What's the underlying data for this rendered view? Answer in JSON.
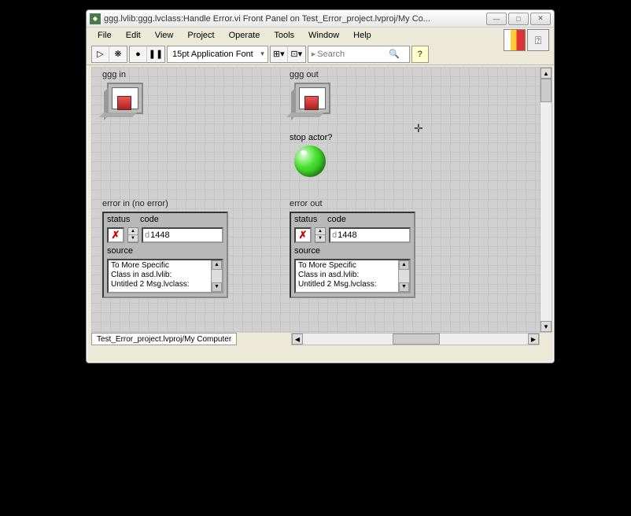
{
  "window": {
    "title": "ggg.lvlib:ggg.lvclass:Handle Error.vi Front Panel on Test_Error_project.lvproj/My Co..."
  },
  "menu": {
    "file": "File",
    "edit": "Edit",
    "view": "View",
    "project": "Project",
    "operate": "Operate",
    "tools": "Tools",
    "window": "Window",
    "help": "Help"
  },
  "toolbar": {
    "font": "15pt Application Font",
    "search_placeholder": "Search"
  },
  "controls": {
    "ggg_in_label": "ggg in",
    "ggg_out_label": "ggg out",
    "stop_actor_label": "stop actor?",
    "error_in_label": "error in (no error)",
    "error_out_label": "error out",
    "status_label": "status",
    "code_label": "code",
    "source_label": "source"
  },
  "error_in": {
    "status_symbol": "✗",
    "code": "1448",
    "source_lines": [
      "To More Specific",
      "Class in asd.lvlib:",
      "Untitled 2 Msg.lvclass:"
    ]
  },
  "error_out": {
    "status_symbol": "✗",
    "code": "1448",
    "source_lines": [
      "To More Specific",
      "Class in asd.lvlib:",
      "Untitled 2 Msg.lvclass:"
    ]
  },
  "tab": "Test_Error_project.lvproj/My Computer",
  "icons": {
    "run": "▷",
    "run_cont": "❋",
    "abort": "●",
    "pause": "❚❚",
    "align": "⊞▾",
    "dist": "⊡▾",
    "mag": "🔍",
    "help": "?",
    "ctx": "⍰",
    "min": "—",
    "max": "□",
    "close": "✕",
    "up": "▲",
    "down": "▼",
    "left": "◀",
    "right": "▶"
  }
}
